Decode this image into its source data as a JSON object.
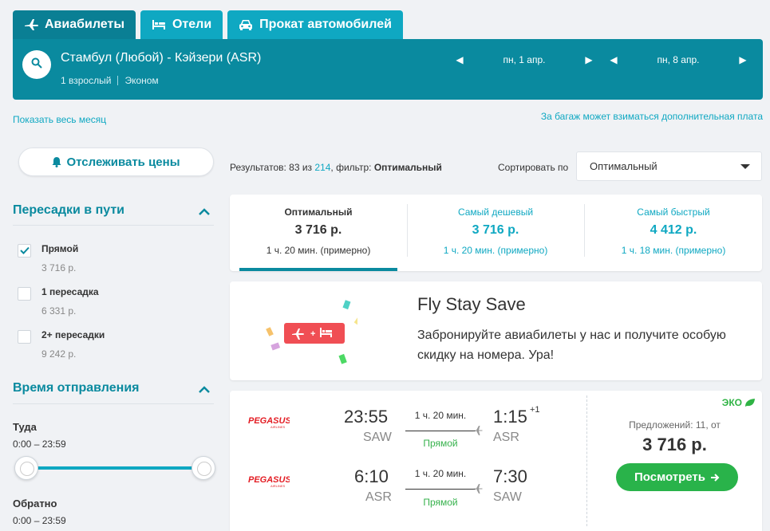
{
  "tabs": [
    {
      "label": "Авиабилеты",
      "icon": "plane-icon"
    },
    {
      "label": "Отели",
      "icon": "bed-icon"
    },
    {
      "label": "Прокат автомобилей",
      "icon": "car-icon"
    }
  ],
  "search": {
    "route": "Стамбул (Любой) - Кэйзери (ASR)",
    "passengers": "1 взрослый",
    "cabin": "Эконом",
    "depart_date": "пн, 1 апр.",
    "return_date": "пн, 8 апр."
  },
  "links": {
    "show_month": "Показать весь месяц",
    "baggage": "За багаж может взиматься дополнительная плата"
  },
  "sidebar": {
    "track_label": "Отслеживать цены",
    "stops_title": "Пересадки в пути",
    "stops": [
      {
        "label": "Прямой",
        "price": "3 716 р.",
        "checked": true
      },
      {
        "label": "1 пересадка",
        "price": "6 331 р.",
        "checked": false
      },
      {
        "label": "2+ пересадки",
        "price": "9 242 р.",
        "checked": false
      }
    ],
    "time_title": "Время отправления",
    "outbound_label": "Туда",
    "outbound_range": "0:00 – 23:59",
    "return_label": "Обратно",
    "return_range": "0:00 – 23:59"
  },
  "results": {
    "prefix": "Результатов: 83 из ",
    "total": "214",
    "filter_prefix": ", фильтр: ",
    "filter": "Оптимальный",
    "sort_label": "Сортировать по",
    "sort_value": "Оптимальный"
  },
  "summary": [
    {
      "title": "Оптимальный",
      "price": "3 716 р.",
      "duration": "1 ч. 20 мин. (примерно)",
      "active": true
    },
    {
      "title": "Самый дешевый",
      "price": "3 716 р.",
      "duration": "1 ч. 20 мин. (примерно)",
      "active": false
    },
    {
      "title": "Самый быстрый",
      "price": "4 412 р.",
      "duration": "1 ч. 18 мин. (примерно)",
      "active": false
    }
  ],
  "promo": {
    "title": "Fly Stay Save",
    "text": "Забронируйте авиабилеты у нас и получите особую скидку на номера. Ура!"
  },
  "flight": {
    "airline": "PEGASUS",
    "airline_sub": "AIRLINES",
    "eco_label": "ЭКО",
    "offers": "Предложений: 11, от",
    "price": "3 716 р.",
    "button": "Посмотреть",
    "outbound": {
      "dep_time": "23:55",
      "dep_code": "SAW",
      "duration": "1 ч. 20 мин.",
      "stops": "Прямой",
      "arr_time": "1:15",
      "arr_plus": "+1",
      "arr_code": "ASR"
    },
    "inbound": {
      "dep_time": "6:10",
      "dep_code": "ASR",
      "duration": "1 ч. 20 мин.",
      "stops": "Прямой",
      "arr_time": "7:30",
      "arr_code": "SAW"
    }
  },
  "colors": {
    "primary": "#0a8a9f",
    "accent": "#0fa8c2",
    "green": "#29b34a",
    "promo_red": "#f04e54"
  }
}
